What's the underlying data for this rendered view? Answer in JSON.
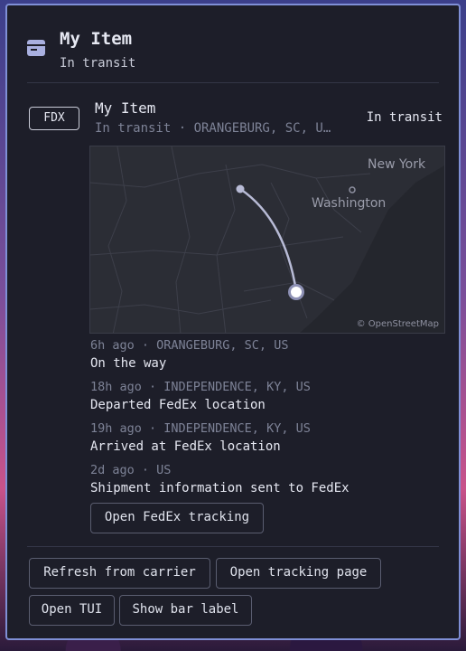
{
  "header": {
    "title": "My Item",
    "status": "In transit",
    "icon": "package-icon"
  },
  "item": {
    "carrier_badge": "FDX",
    "title": "My Item",
    "subtitle": "In transit · ORANGEBURG, SC, U…",
    "status": "In transit"
  },
  "map": {
    "labels": {
      "new_york": "New York",
      "washington": "Washington"
    },
    "attribution": "© OpenStreetMap",
    "route": {
      "origin": "INDEPENDENCE, KY, US",
      "destination": "ORANGEBURG, SC, US"
    }
  },
  "events": [
    {
      "meta": "6h ago · ORANGEBURG, SC, US",
      "desc": "On the way"
    },
    {
      "meta": "18h ago · INDEPENDENCE, KY, US",
      "desc": "Departed FedEx location"
    },
    {
      "meta": "19h ago · INDEPENDENCE, KY, US",
      "desc": "Arrived at FedEx location"
    },
    {
      "meta": "2d ago · US",
      "desc": "Shipment information sent to FedEx"
    }
  ],
  "buttons": {
    "open_fedex": "Open FedEx tracking",
    "refresh": "Refresh from carrier",
    "open_page": "Open tracking page",
    "open_tui": "Open TUI",
    "show_bar": "Show bar label"
  },
  "colors": {
    "accent": "#7f8fd6",
    "panel_bg": "#1d1e29",
    "route": "#b8bbd6"
  }
}
